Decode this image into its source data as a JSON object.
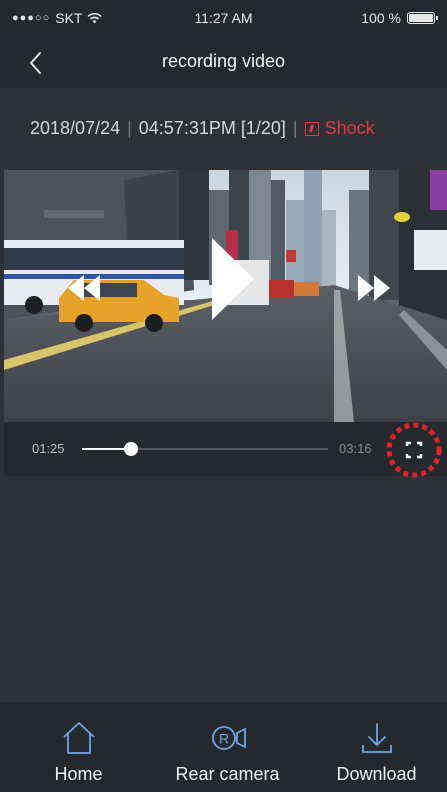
{
  "status_bar": {
    "carrier": "SKT",
    "time": "11:27 AM",
    "battery_text": "100 %",
    "battery_level": 1.0
  },
  "nav": {
    "title": "recording video",
    "back_icon": "chevron-left-icon"
  },
  "recording_info": {
    "date": "2018/07/24",
    "time": "04:57:31PM",
    "index": "[1/20]",
    "event_label": "Shock",
    "event_icon": "shock-icon",
    "event_color": "#e23b3b"
  },
  "player": {
    "current_time": "01:25",
    "total_time": "03:16",
    "progress": 0.2,
    "play_icon": "play-icon",
    "rewind_icon": "rewind-icon",
    "fast_forward_icon": "fast-forward-icon",
    "fullscreen_icon": "fullscreen-icon",
    "highlight_color": "#e0202a"
  },
  "tabs": [
    {
      "label": "Home",
      "icon": "home-icon"
    },
    {
      "label": "Rear camera",
      "icon": "rear-camera-icon"
    },
    {
      "label": "Download",
      "icon": "download-icon"
    }
  ]
}
